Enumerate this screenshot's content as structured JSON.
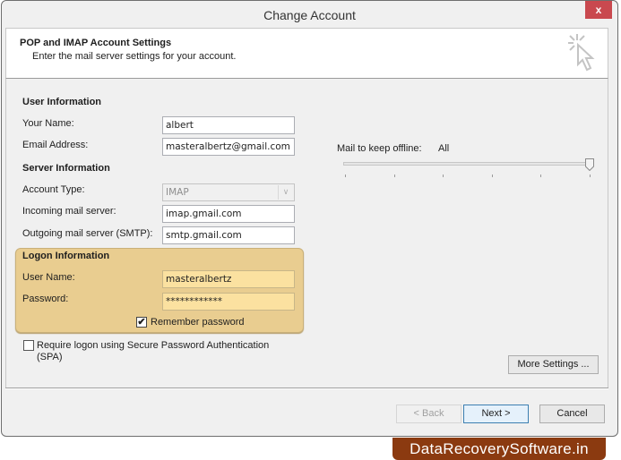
{
  "window": {
    "title": "Change Account",
    "close_label": "x"
  },
  "header": {
    "title": "POP and IMAP Account Settings",
    "subtitle": "Enter the mail server settings for your account.",
    "icon": "cursor-click-icon"
  },
  "user_info": {
    "heading": "User Information",
    "name_label": "Your Name:",
    "name_value": "albert",
    "email_label": "Email Address:",
    "email_value": "masteralbertz@gmail.com"
  },
  "server_info": {
    "heading": "Server Information",
    "account_type_label": "Account Type:",
    "account_type_value": "IMAP",
    "incoming_label": "Incoming mail server:",
    "incoming_value": "imap.gmail.com",
    "outgoing_label": "Outgoing mail server (SMTP):",
    "outgoing_value": "smtp.gmail.com"
  },
  "logon_info": {
    "heading": "Logon Information",
    "username_label": "User Name:",
    "username_value": "masteralbertz",
    "password_label": "Password:",
    "password_value": "************",
    "remember_label": "Remember password",
    "remember_checked": true
  },
  "spa": {
    "label_line1": "Require logon using Secure Password Authentication",
    "label_line2": "(SPA)",
    "checked": false
  },
  "offline": {
    "label": "Mail to keep offline:",
    "value": "All",
    "slider_position": 1.0,
    "tick_count": 6
  },
  "buttons": {
    "more_settings": "More Settings ...",
    "back": "< Back",
    "next": "Next >",
    "cancel": "Cancel"
  },
  "watermark": "DataRecoverySoftware.in"
}
